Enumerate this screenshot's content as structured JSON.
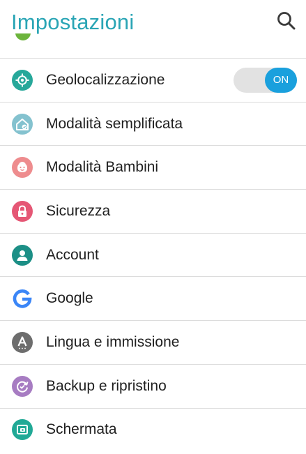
{
  "header": {
    "title": "Impostazioni",
    "search_icon": "search-icon"
  },
  "items": [
    {
      "label": "Geolocalizzazione",
      "icon": "location-target-icon",
      "color": "#27a89a",
      "toggle": "ON"
    },
    {
      "label": "Modalità semplificata",
      "icon": "easy-mode-house-icon",
      "color": "#84c2cf"
    },
    {
      "label": "Modalità Bambini",
      "icon": "kids-face-icon",
      "color": "#ee8c8e"
    },
    {
      "label": "Sicurezza",
      "icon": "lock-icon",
      "color": "#e55775"
    },
    {
      "label": "Account",
      "icon": "account-person-icon",
      "color": "#1c8f86"
    },
    {
      "label": "Google",
      "icon": "google-g-icon",
      "color": "#3b86f7"
    },
    {
      "label": "Lingua e immissione",
      "icon": "language-a-icon",
      "color": "#6d6d6d"
    },
    {
      "label": "Backup e ripristino",
      "icon": "backup-restore-icon",
      "color": "#a77cc2"
    },
    {
      "label": "Schermata",
      "icon": "screenshot-icon",
      "color": "#21a996"
    }
  ],
  "colors": {
    "accent": "#2aa5b5",
    "toggle_on": "#1aa0dd",
    "divider": "#dcdcdc"
  }
}
